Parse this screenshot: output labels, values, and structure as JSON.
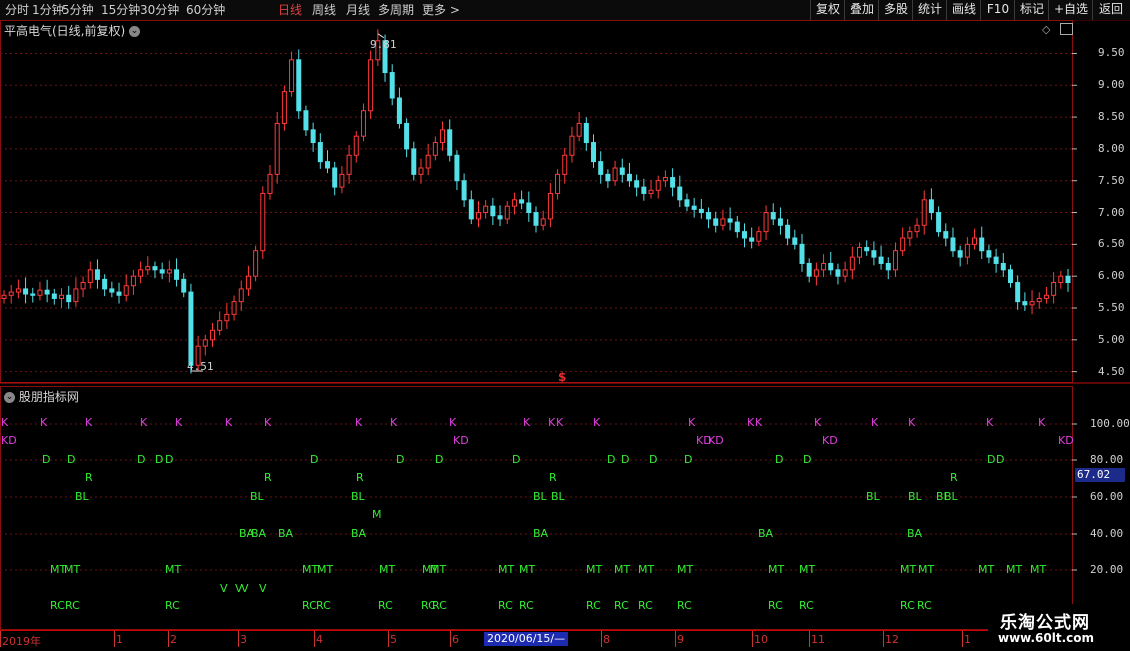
{
  "toolbar": {
    "periods": [
      "分时",
      "1分钟",
      "5分钟",
      "15分钟",
      "30分钟",
      "60分钟",
      "日线",
      "周线",
      "月线",
      "多周期",
      "更多 >"
    ],
    "active_period": "日线",
    "right_buttons": [
      "复权",
      "叠加",
      "多股",
      "统计",
      "画线",
      "F10",
      "标记",
      "+自选",
      "返回"
    ]
  },
  "price_panel": {
    "title": "平高电气(日线,前复权)",
    "high_label": "9.81",
    "low_label": "4.51",
    "marker": "$",
    "y_ticks": [
      "9.50",
      "9.00",
      "8.50",
      "8.00",
      "7.50",
      "7.00",
      "6.50",
      "6.00",
      "5.50",
      "5.00",
      "4.50"
    ],
    "colors": {
      "up": "#ff3a3a",
      "down": "#54e0e8",
      "grid": "#7a1a1a"
    }
  },
  "indicator_panel": {
    "title": "股朋指标网",
    "y_ticks": [
      "100.00",
      "80.00",
      "60.00",
      "40.00",
      "20.00"
    ],
    "current_value": "67.02"
  },
  "time_axis": {
    "labels": [
      "2019年",
      "1",
      "2",
      "3",
      "4",
      "5",
      "6",
      "8",
      "9",
      "10",
      "11",
      "12",
      "1"
    ],
    "cursor_date": "2020/06/15/—"
  },
  "watermark": {
    "name": "乐淘公式网",
    "url": "www.60lt.com"
  },
  "chart_data": {
    "type": "candlestick",
    "title": "平高电气(日线,前复权)",
    "y_range": [
      4.4,
      9.9
    ],
    "close_series": [
      5.7,
      5.75,
      5.8,
      5.72,
      5.7,
      5.78,
      5.72,
      5.65,
      5.7,
      5.6,
      5.8,
      5.9,
      6.1,
      5.95,
      5.8,
      5.75,
      5.7,
      5.85,
      6.0,
      6.1,
      6.15,
      6.1,
      6.05,
      6.1,
      5.95,
      5.75,
      4.6,
      4.9,
      5.0,
      5.15,
      5.3,
      5.4,
      5.6,
      5.8,
      6.0,
      6.4,
      7.3,
      7.6,
      8.4,
      8.9,
      9.4,
      8.6,
      8.3,
      8.1,
      7.8,
      7.7,
      7.4,
      7.6,
      7.9,
      8.2,
      8.6,
      9.4,
      9.7,
      9.2,
      8.8,
      8.4,
      8.0,
      7.6,
      7.7,
      7.9,
      8.1,
      8.3,
      7.9,
      7.5,
      7.2,
      6.9,
      7.0,
      7.1,
      6.95,
      6.9,
      7.1,
      7.2,
      7.15,
      7.0,
      6.8,
      6.9,
      7.3,
      7.6,
      7.9,
      8.2,
      8.4,
      8.1,
      7.8,
      7.6,
      7.5,
      7.7,
      7.6,
      7.5,
      7.4,
      7.3,
      7.35,
      7.5,
      7.55,
      7.4,
      7.2,
      7.1,
      7.05,
      7.0,
      6.9,
      6.8,
      6.9,
      6.85,
      6.7,
      6.6,
      6.55,
      6.7,
      7.0,
      6.9,
      6.8,
      6.6,
      6.5,
      6.2,
      6.0,
      6.1,
      6.2,
      6.1,
      6.0,
      6.1,
      6.3,
      6.45,
      6.4,
      6.3,
      6.2,
      6.1,
      6.4,
      6.6,
      6.7,
      6.8,
      7.2,
      7.0,
      6.7,
      6.6,
      6.4,
      6.3,
      6.5,
      6.6,
      6.4,
      6.3,
      6.2,
      6.1,
      5.9,
      5.6,
      5.55,
      5.6,
      5.65,
      5.7,
      5.9,
      6.0,
      5.9
    ],
    "high_point": {
      "value": 9.81
    },
    "low_point": {
      "value": 4.51
    }
  },
  "signal_rows": [
    {
      "text": "K",
      "cls": "sigK",
      "row": 0,
      "xs": [
        1,
        40,
        85,
        140,
        175,
        225,
        264,
        355,
        390,
        449,
        523,
        548,
        556,
        593,
        688,
        747,
        755,
        814,
        871,
        908,
        986,
        1038
      ]
    },
    {
      "text": "KD",
      "cls": "sigK",
      "row": 1,
      "xs": [
        1,
        453,
        696,
        708,
        822,
        1058
      ]
    },
    {
      "text": "D",
      "cls": "sigG",
      "row": 2,
      "xs": [
        42,
        67,
        137,
        155,
        165,
        310,
        396,
        435,
        512,
        607,
        621,
        649,
        684,
        775,
        803,
        987,
        996
      ]
    },
    {
      "text": "R",
      "cls": "sigG",
      "row": 3,
      "xs": [
        85,
        264,
        356,
        549,
        950
      ]
    },
    {
      "text": "BL",
      "cls": "sigG",
      "row": 4,
      "xs": [
        75,
        250,
        351,
        533,
        551,
        866,
        908,
        936,
        944
      ]
    },
    {
      "text": "M",
      "cls": "sigG",
      "row": 5,
      "xs": [
        372
      ]
    },
    {
      "text": "BA",
      "cls": "sigG",
      "row": 6,
      "xs": [
        239,
        251,
        278,
        351,
        533,
        758,
        907
      ]
    },
    {
      "text": "MT",
      "cls": "sigG",
      "row": 7,
      "xs": [
        50,
        64,
        165,
        302,
        317,
        379,
        422,
        430,
        498,
        519,
        586,
        614,
        638,
        677,
        768,
        799,
        900,
        918,
        978,
        1006,
        1030
      ]
    },
    {
      "text": "V",
      "cls": "sigV",
      "row": 8,
      "xs": [
        220,
        235,
        241,
        259
      ]
    },
    {
      "text": "RC",
      "cls": "sigG",
      "row": 9,
      "xs": [
        50,
        65,
        165,
        302,
        316,
        378,
        421,
        432,
        498,
        519,
        586,
        614,
        638,
        677,
        768,
        799,
        900,
        917
      ]
    }
  ]
}
